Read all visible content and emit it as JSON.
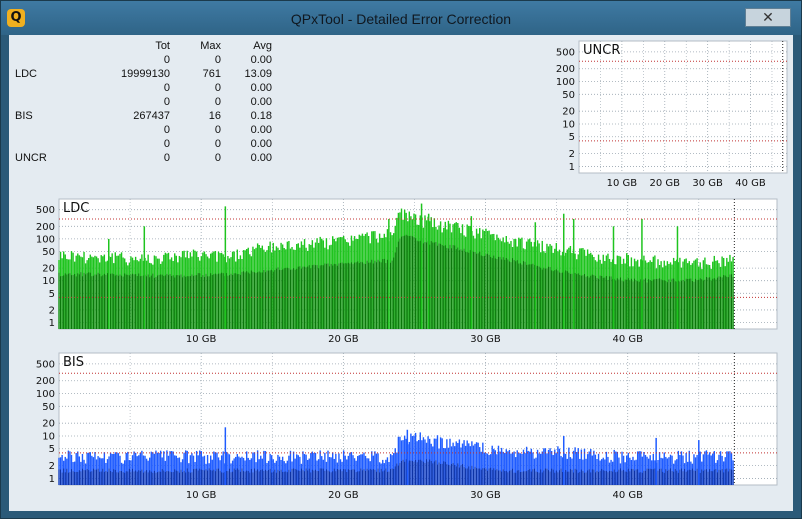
{
  "window": {
    "title": "QPxTool - Detailed Error Correction",
    "icon": "Q",
    "close_glyph": "✕"
  },
  "stats": {
    "headers": [
      "",
      "Tot",
      "Max",
      "Avg"
    ],
    "rows": [
      {
        "label": "",
        "tot": "0",
        "max": "0",
        "avg": "0.00"
      },
      {
        "label": "LDC",
        "tot": "19999130",
        "max": "761",
        "avg": "13.09"
      },
      {
        "label": "",
        "tot": "0",
        "max": "0",
        "avg": "0.00"
      },
      {
        "label": "",
        "tot": "0",
        "max": "0",
        "avg": "0.00"
      },
      {
        "label": "BIS",
        "tot": "267437",
        "max": "16",
        "avg": "0.18"
      },
      {
        "label": "",
        "tot": "0",
        "max": "0",
        "avg": "0.00"
      },
      {
        "label": "",
        "tot": "0",
        "max": "0",
        "avg": "0.00"
      },
      {
        "label": "UNCR",
        "tot": "0",
        "max": "0",
        "avg": "0.00"
      }
    ]
  },
  "colors": {
    "ldc_light": "#1ec41e",
    "ldc_dark": "#0a6e0a",
    "bis_light": "#1f5cff",
    "bis_dark": "#0d2f9a",
    "limit_line": "#c03030",
    "grid": "#9aa6b0",
    "plot_bg": "#ffffff"
  },
  "chart_data": [
    {
      "type": "area",
      "title": "UNCR",
      "scale": "log",
      "y_tick_labels": [
        "500",
        "200",
        "100",
        "50",
        "20",
        "10",
        "5",
        "2",
        "1"
      ],
      "y_ticks": [
        500,
        200,
        100,
        50,
        20,
        10,
        5,
        2,
        1
      ],
      "x_tick_labels": [
        "10 GB",
        "20 GB",
        "30 GB",
        "40 GB"
      ],
      "x_ticks": [
        10,
        20,
        30,
        40
      ],
      "xlim": [
        0,
        48.5
      ],
      "disc_end_gb": 47.5,
      "limit_lines": [
        300,
        4
      ],
      "series": []
    },
    {
      "type": "area",
      "title": "LDC",
      "scale": "log",
      "y_tick_labels": [
        "500",
        "200",
        "100",
        "50",
        "20",
        "10",
        "5",
        "2",
        "1"
      ],
      "y_ticks": [
        500,
        200,
        100,
        50,
        20,
        10,
        5,
        2,
        1
      ],
      "x_tick_labels": [
        "10 GB",
        "20 GB",
        "30 GB",
        "40 GB"
      ],
      "x_ticks": [
        10,
        20,
        30,
        40
      ],
      "xlim": [
        0,
        50.5
      ],
      "disc_end_gb": 47.5,
      "limit_lines": [
        300,
        4
      ],
      "series": [
        {
          "role": "max",
          "x": [
            0,
            3,
            6,
            9,
            12,
            14,
            17,
            20,
            22,
            23.5,
            24,
            26,
            28,
            30,
            32,
            34,
            36,
            38,
            40,
            42,
            44,
            46,
            47.3
          ],
          "values": [
            50,
            45,
            40,
            50,
            45,
            70,
            90,
            110,
            140,
            160,
            500,
            300,
            220,
            160,
            110,
            80,
            60,
            45,
            40,
            35,
            30,
            35,
            40
          ]
        },
        {
          "role": "avg",
          "x": [
            0,
            3,
            6,
            9,
            12,
            14,
            17,
            20,
            22,
            23.5,
            24,
            26,
            28,
            30,
            32,
            34,
            36,
            38,
            40,
            42,
            44,
            46,
            47.3
          ],
          "values": [
            14,
            14,
            13,
            13,
            14,
            17,
            20,
            25,
            28,
            30,
            120,
            80,
            60,
            40,
            30,
            20,
            15,
            12,
            10,
            10,
            10,
            11,
            13
          ]
        }
      ],
      "spikes": [
        {
          "x": 11.7,
          "value": 600
        },
        {
          "x": 6.0,
          "value": 200
        },
        {
          "x": 3.5,
          "value": 100
        },
        {
          "x": 23.2,
          "value": 300
        },
        {
          "x": 25.5,
          "value": 700
        },
        {
          "x": 26.0,
          "value": 400
        },
        {
          "x": 29.0,
          "value": 350
        },
        {
          "x": 33.5,
          "value": 250
        },
        {
          "x": 35.5,
          "value": 400
        },
        {
          "x": 36.2,
          "value": 300
        },
        {
          "x": 39.0,
          "value": 200
        },
        {
          "x": 41.0,
          "value": 300
        },
        {
          "x": 43.5,
          "value": 200
        }
      ]
    },
    {
      "type": "area",
      "title": "BIS",
      "scale": "log",
      "y_tick_labels": [
        "500",
        "200",
        "100",
        "50",
        "20",
        "10",
        "5",
        "2",
        "1"
      ],
      "y_ticks": [
        500,
        200,
        100,
        50,
        20,
        10,
        5,
        2,
        1
      ],
      "x_tick_labels": [
        "10 GB",
        "20 GB",
        "30 GB",
        "40 GB"
      ],
      "x_ticks": [
        10,
        20,
        30,
        40
      ],
      "xlim": [
        0,
        50.5
      ],
      "disc_end_gb": 47.5,
      "limit_lines": [
        300,
        4
      ],
      "series": [
        {
          "role": "max",
          "x": [
            0,
            5,
            10,
            15,
            20,
            23.5,
            24,
            26,
            28,
            30,
            32,
            35,
            40,
            45,
            47.3
          ],
          "values": [
            4,
            4,
            4,
            4,
            4,
            4,
            12,
            10,
            8,
            6,
            5,
            5,
            4,
            4,
            4
          ]
        },
        {
          "role": "avg",
          "x": [
            0,
            5,
            10,
            15,
            20,
            23.5,
            24,
            26,
            28,
            30,
            32,
            35,
            40,
            45,
            47.3
          ],
          "values": [
            1.5,
            1.5,
            1.5,
            1.5,
            1.5,
            1.5,
            2.5,
            2.5,
            2,
            1.6,
            1.5,
            1.5,
            1.5,
            1.5,
            1.5
          ]
        }
      ],
      "spikes": [
        {
          "x": 11.7,
          "value": 16
        },
        {
          "x": 24.5,
          "value": 14
        },
        {
          "x": 35.5,
          "value": 10
        },
        {
          "x": 42.0,
          "value": 9
        },
        {
          "x": 45.0,
          "value": 8
        }
      ]
    }
  ]
}
